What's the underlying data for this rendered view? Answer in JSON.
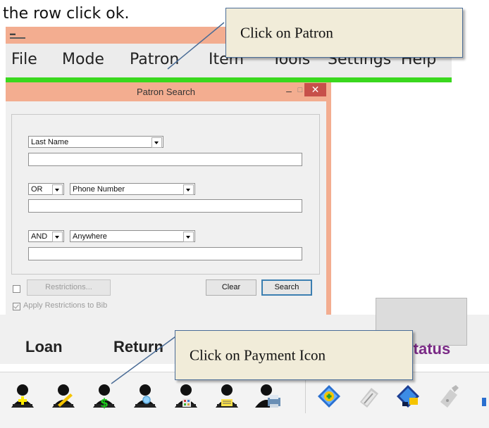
{
  "document_text": "the row click ok.",
  "app": {
    "menu": [
      "File",
      "Mode",
      "Patron",
      "Item",
      "Tools",
      "Settings",
      "Help"
    ],
    "accent_green": "#3ad81e",
    "title_color": "#f3ad90"
  },
  "callouts": {
    "patron": "Click on Patron",
    "payment": "Click on Payment Icon"
  },
  "dialog": {
    "title": "Patron Search",
    "min_glyph": "–",
    "max_glyph": "□",
    "close_glyph": "✕",
    "field1": {
      "selected": "Last Name",
      "value": ""
    },
    "row2": {
      "operator": "OR",
      "selected": "Phone Number",
      "value": ""
    },
    "row3": {
      "operator": "AND",
      "selected": "Anywhere",
      "value": ""
    },
    "restrictions_button": "Restrictions...",
    "restrictions_checked": false,
    "apply_restrictions_label": "Apply Restrictions to Bib",
    "apply_restrictions_checked": true,
    "clear_button": "Clear",
    "search_button": "Search"
  },
  "tabs": [
    "Loan",
    "Return",
    "Status"
  ],
  "toolbar": {
    "icons": [
      "patron-add-icon",
      "patron-edit-icon",
      "patron-payment-icon",
      "patron-search-icon",
      "patron-building-icon",
      "patron-note-icon",
      "patron-print-icon",
      "item-add-icon",
      "item-edit-icon",
      "item-book-icon",
      "item-tag-icon"
    ]
  }
}
